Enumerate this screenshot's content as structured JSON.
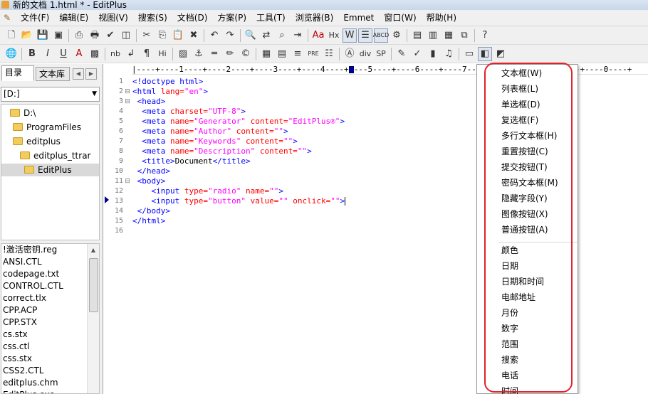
{
  "window": {
    "title": "新的文档 1.html * - EditPlus"
  },
  "menu": [
    "文件(F)",
    "编辑(E)",
    "视图(V)",
    "搜索(S)",
    "文档(D)",
    "方案(P)",
    "工具(T)",
    "浏览器(B)",
    "Emmet",
    "窗口(W)",
    "帮助(H)"
  ],
  "toolbar1": [
    "new-file-icon",
    "open-folder-icon",
    "save-icon",
    "save-all-icon",
    "|",
    "print-preview-icon",
    "print-icon",
    "spell-check-icon",
    "browser-preview-icon",
    "|",
    "cut-icon",
    "copy-icon",
    "paste-icon",
    "delete-icon",
    "|",
    "undo-icon",
    "redo-icon",
    "|",
    "find-icon",
    "replace-icon",
    "find-in-files-icon",
    "goto-line-icon",
    "|",
    "font-icon",
    "hex-icon",
    "word-wrap-icon",
    "line-number-icon",
    "column-select-icon",
    "settings-icon",
    "|",
    "list-view-icon",
    "output-window-icon",
    "cliptext-icon",
    "new-window-icon",
    "|",
    "help-icon"
  ],
  "toolbar2": [
    "globe-icon",
    "|",
    "bold-icon",
    "italic-icon",
    "underline-icon",
    "font-color-icon",
    "color-picker-icon",
    "|",
    "nbsp-icon",
    "line-break-icon",
    "paragraph-icon",
    "heading-icon",
    "|",
    "image-icon",
    "anchor-icon",
    "hr-icon",
    "highlight-icon",
    "comment-icon",
    "|",
    "table-icon",
    "table-row-icon",
    "align-icon",
    "pre-icon",
    "list-icon",
    "|",
    "style-icon",
    "div-icon",
    "span-icon",
    "|",
    "form-icon",
    "check-icon",
    "media-icon",
    "music-icon",
    "|",
    "input-icon",
    "form-controls-icon",
    "template-icon"
  ],
  "toolbar1_text": {
    "font-icon": "Aa",
    "hex-icon": "Hx",
    "word-wrap-icon": "W",
    "column-select-icon": "ABCD"
  },
  "toolbar2_text": {
    "bold-icon": "B",
    "italic-icon": "I",
    "underline-icon": "U",
    "font-color-icon": "A",
    "nbsp-icon": "nb",
    "line-break-icon": "↲",
    "paragraph-icon": "¶",
    "heading-icon": "Hi",
    "pre-icon": "PRE",
    "div-icon": "div",
    "span-icon": "SP"
  },
  "sidebar": {
    "tabs": [
      "目录",
      "文本库"
    ],
    "drive": "[D:]",
    "folders": [
      "D:\\",
      "ProgramFiles",
      "editplus",
      "editplus_ttrar",
      "EditPlus"
    ],
    "files": [
      "!激活密钥.reg",
      "ANSI.CTL",
      "codepage.txt",
      "CONTROL.CTL",
      "correct.tlx",
      "CPP.ACP",
      "CPP.STX",
      "cs.stx",
      "css.ctl",
      "css.stx",
      "CSS2.CTL",
      "editplus.chm",
      "EditPlus.exe"
    ]
  },
  "editor": {
    "ruler": "|----+----1----+----2----+----3----+----4----+----5----+----6----+----7----+----8----+----9----+----0----+",
    "lines": [
      [
        [
          "<!doctype html>",
          "t"
        ]
      ],
      [
        [
          "<html ",
          "t"
        ],
        [
          "lang=",
          "a"
        ],
        [
          "\"en\"",
          "s"
        ],
        [
          ">",
          "t"
        ]
      ],
      [
        [
          " <head>",
          "t"
        ]
      ],
      [
        [
          "  <meta ",
          "t"
        ],
        [
          "charset=",
          "a"
        ],
        [
          "\"UTF-8\"",
          "s"
        ],
        [
          ">",
          "t"
        ]
      ],
      [
        [
          "  <meta ",
          "t"
        ],
        [
          "name=",
          "a"
        ],
        [
          "\"Generator\" ",
          "s"
        ],
        [
          "content=",
          "a"
        ],
        [
          "\"EditPlus®\"",
          "s"
        ],
        [
          ">",
          "t"
        ]
      ],
      [
        [
          "  <meta ",
          "t"
        ],
        [
          "name=",
          "a"
        ],
        [
          "\"Author\" ",
          "s"
        ],
        [
          "content=",
          "a"
        ],
        [
          "\"\"",
          "s"
        ],
        [
          ">",
          "t"
        ]
      ],
      [
        [
          "  <meta ",
          "t"
        ],
        [
          "name=",
          "a"
        ],
        [
          "\"Keywords\" ",
          "s"
        ],
        [
          "content=",
          "a"
        ],
        [
          "\"\"",
          "s"
        ],
        [
          ">",
          "t"
        ]
      ],
      [
        [
          "  <meta ",
          "t"
        ],
        [
          "name=",
          "a"
        ],
        [
          "\"Description\" ",
          "s"
        ],
        [
          "content=",
          "a"
        ],
        [
          "\"\"",
          "s"
        ],
        [
          ">",
          "t"
        ]
      ],
      [
        [
          "  <title>",
          "t"
        ],
        [
          "Document",
          "p"
        ],
        [
          "</title>",
          "t"
        ]
      ],
      [
        [
          " </head>",
          "t"
        ]
      ],
      [
        [
          " <body>",
          "t"
        ]
      ],
      [
        [
          "    <input ",
          "t"
        ],
        [
          "type=",
          "a"
        ],
        [
          "\"radio\" ",
          "s"
        ],
        [
          "name=",
          "a"
        ],
        [
          "\"\"",
          "s"
        ],
        [
          ">",
          "t"
        ]
      ],
      [
        [
          "    <input ",
          "t"
        ],
        [
          "type=",
          "a"
        ],
        [
          "\"button\" ",
          "s"
        ],
        [
          "value=",
          "a"
        ],
        [
          "\"\" ",
          "s"
        ],
        [
          "onclick=",
          "a"
        ],
        [
          "\"\"",
          "s"
        ],
        [
          ">",
          "t"
        ]
      ],
      [
        [
          " </body>",
          "t"
        ]
      ],
      [
        [
          "</html>",
          "t"
        ]
      ],
      [
        [
          "",
          "p"
        ]
      ]
    ],
    "folds": [
      "",
      "⊟",
      "⊟",
      "",
      "",
      "",
      "",
      "",
      "",
      "",
      "⊟",
      "",
      "",
      "",
      "",
      ""
    ]
  },
  "popup_menu": {
    "group1": [
      "文本框(W)",
      "列表框(L)",
      "单选框(D)",
      "复选框(F)",
      "多行文本框(H)",
      "重置按钮(C)",
      "提交按钮(T)",
      "密码文本框(M)",
      "隐藏字段(Y)",
      "图像按钮(X)",
      "普通按钮(A)"
    ],
    "group2": [
      "颜色",
      "日期",
      "日期和时间",
      "电邮地址",
      "月份",
      "数字",
      "范围",
      "搜索",
      "电话",
      "时间"
    ]
  },
  "colors": {
    "tag": "#0000ff",
    "attribute": "#ff0000",
    "string": "#ff00ff",
    "highlight_border": "#e0222a"
  }
}
